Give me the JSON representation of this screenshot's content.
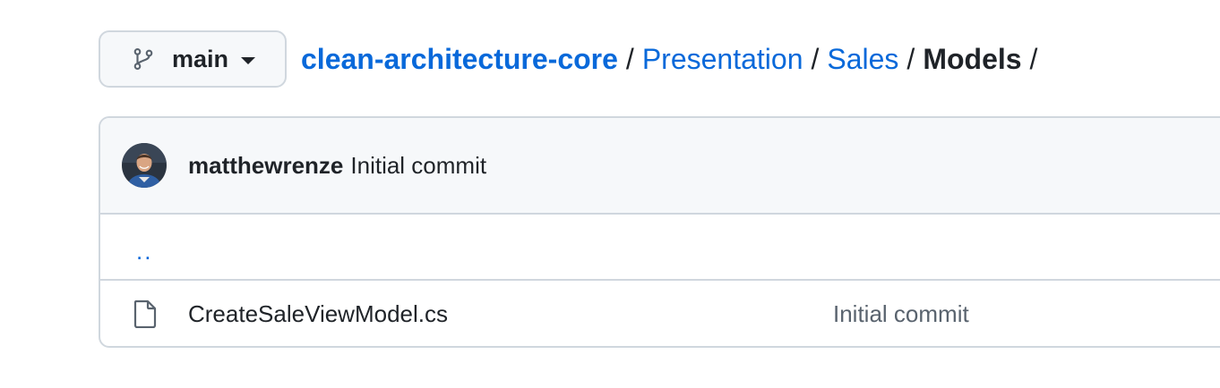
{
  "branch": {
    "icon": "git-branch-icon",
    "label": "main",
    "caret_icon": "triangle-down-icon"
  },
  "breadcrumb": {
    "repo": "clean-architecture-core",
    "path": [
      "Presentation",
      "Sales"
    ],
    "separator": "/",
    "current": "Models",
    "trailing_separator": "/"
  },
  "latest_commit": {
    "author": "matthewrenze",
    "message": "Initial commit",
    "avatar_icon": "user-avatar"
  },
  "files": {
    "parent_link": "..",
    "items": [
      {
        "icon": "file-icon",
        "name": "CreateSaleViewModel.cs",
        "last_commit": "Initial commit"
      }
    ]
  },
  "colors": {
    "link": "#0969da",
    "text": "#1f2328",
    "muted": "#59636e",
    "border": "#d0d7de",
    "header_bg": "#f6f8fa"
  }
}
